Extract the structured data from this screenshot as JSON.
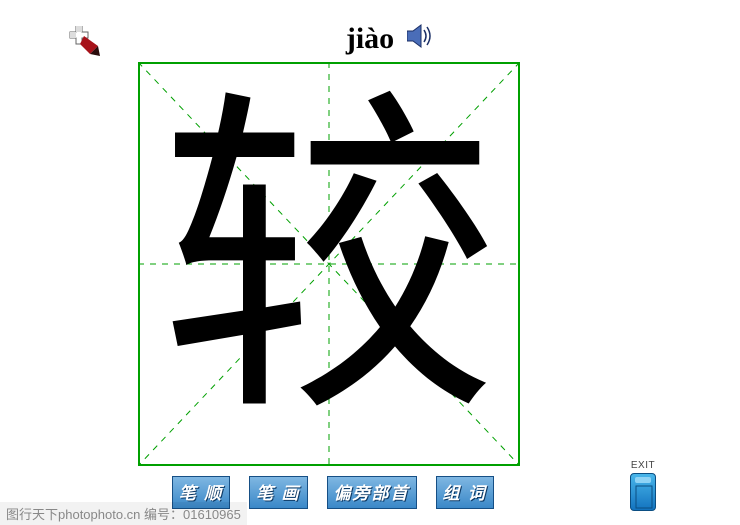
{
  "pinyin": "jiào",
  "character": "较",
  "icons": {
    "brush_cursor": "brush-cursor",
    "speaker": "sound"
  },
  "buttons": {
    "strokeOrder": "笔 顺",
    "strokes": "笔 画",
    "radical": "偏旁部首",
    "compound": "组 词"
  },
  "exit": {
    "label": "EXIT"
  },
  "watermark": "图行天下photophoto.cn  编号：01610965"
}
